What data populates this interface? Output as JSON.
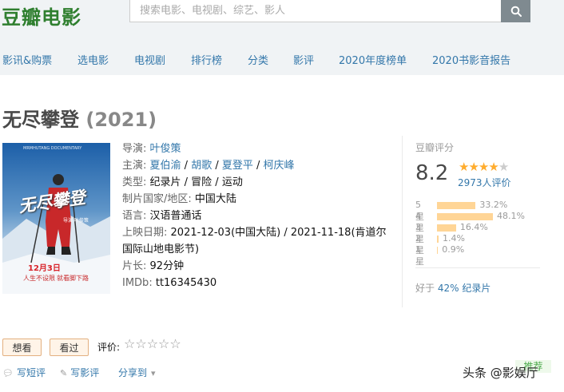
{
  "header": {
    "logo": "豆瓣电影",
    "search_placeholder": "搜索电影、电视剧、综艺、影人",
    "nav": [
      "影讯&购票",
      "选电影",
      "电视剧",
      "排行榜",
      "分类",
      "影评",
      "2020年度榜单",
      "2020书影音报告"
    ]
  },
  "movie": {
    "title": "无尽攀登",
    "year": "(2021)",
    "poster": {
      "title_text": "无尽攀登",
      "release_badge": "12月3日",
      "tagline_1": "人生不设限",
      "tagline_2": "就看脚下路",
      "studio_text": "MRMHUTANG DOCUMENTARY",
      "director_line": "导演 叶俊策"
    },
    "info": {
      "director_label": "导演:",
      "director": "叶俊策",
      "cast_label": "主演:",
      "cast": [
        "夏伯渝",
        "胡歌",
        "夏登平",
        "柯庆峰"
      ],
      "sep": " / ",
      "genre_label": "类型:",
      "genres": "纪录片 / 冒险 / 运动",
      "country_label": "制片国家/地区:",
      "country": "中国大陆",
      "language_label": "语言:",
      "language": "汉语普通话",
      "release_label": "上映日期:",
      "release_1": "2021-12-03(中国大陆)",
      "release_2": "2021-11-18(肯道尔国际山地电影节)",
      "runtime_label": "片长:",
      "runtime": "92分钟",
      "imdb_label": "IMDb:",
      "imdb": "tt16345430"
    }
  },
  "rating": {
    "label": "豆瓣评分",
    "score": "8.2",
    "stars_filled": 4,
    "stars_total": 5,
    "votes": "2973人评价",
    "distribution": [
      {
        "star": "5星",
        "percent": 33.2,
        "text": "33.2%"
      },
      {
        "star": "4星",
        "percent": 48.1,
        "text": "48.1%"
      },
      {
        "star": "3星",
        "percent": 16.4,
        "text": "16.4%"
      },
      {
        "star": "2星",
        "percent": 1.4,
        "text": "1.4%"
      },
      {
        "star": "1星",
        "percent": 0.9,
        "text": "0.9%"
      }
    ],
    "better_prefix": "好于",
    "better_link": "42% 纪录片"
  },
  "actions": {
    "want": "想看",
    "seen": "看过",
    "rate_label": "评价:",
    "rate_stars": "☆☆☆☆☆",
    "short_review": "写短评",
    "review": "写影评",
    "share": "分享到",
    "recommend": "推荐"
  },
  "watermark": "头条 @影娱厅",
  "colors": {
    "link": "#3377aa",
    "star": "#ffac2d",
    "bar": "#ffd596",
    "logo": "#2f7f2f",
    "topbar": "#f0f3f5"
  }
}
